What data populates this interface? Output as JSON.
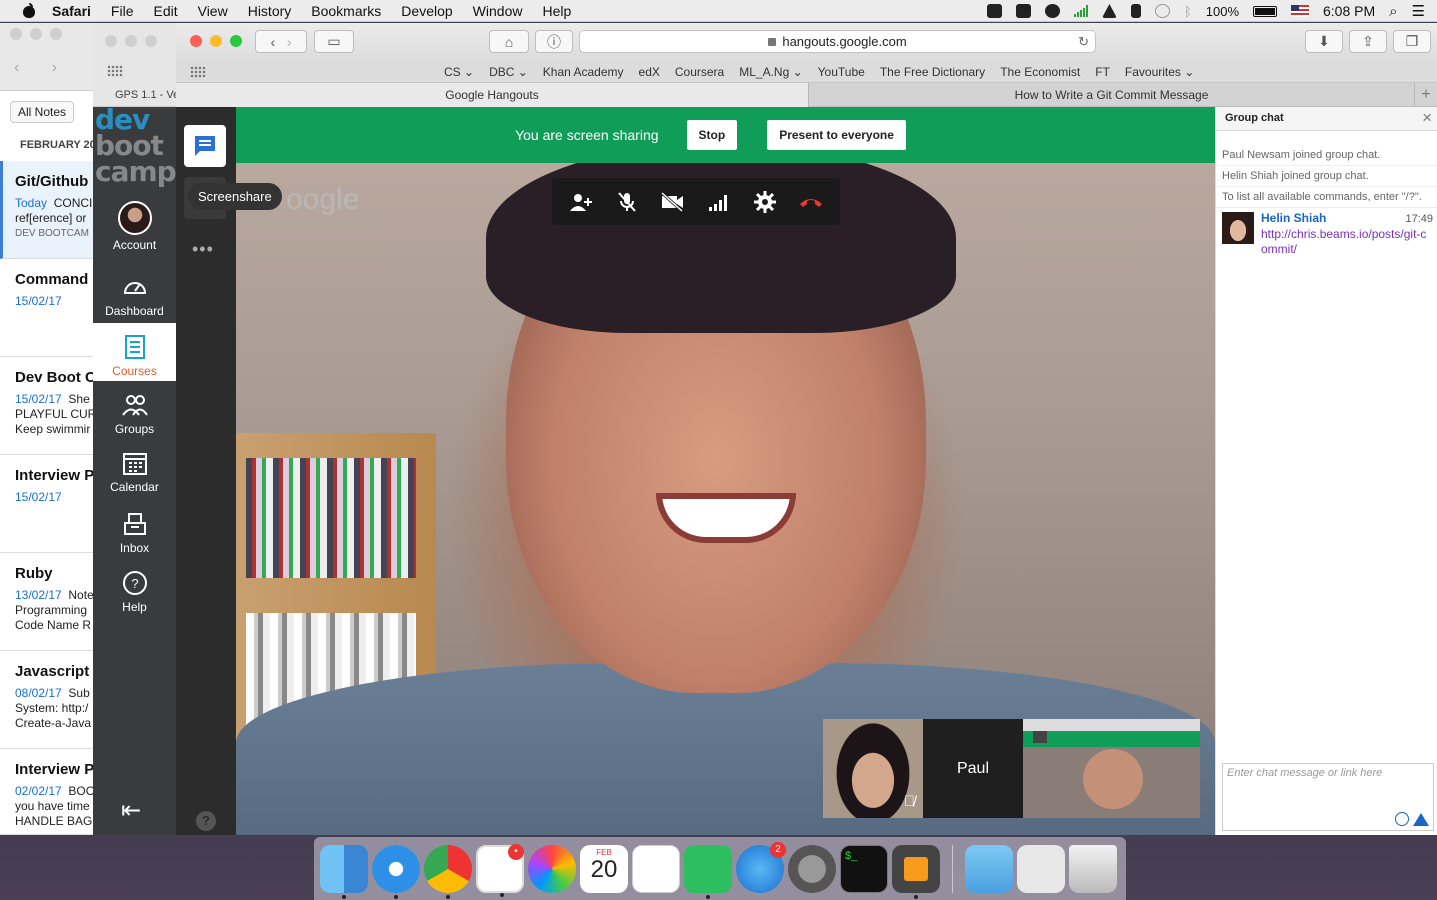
{
  "menubar": {
    "app": "Safari",
    "items": [
      "File",
      "Edit",
      "View",
      "History",
      "Bookmarks",
      "Develop",
      "Window",
      "Help"
    ],
    "battery": "100%",
    "clock": "6:08 PM"
  },
  "notes": {
    "all_notes": "All Notes",
    "month": "FEBRUARY 20",
    "items": [
      {
        "title": "Git/Github",
        "date": "Today",
        "snippet1": "CONCI",
        "snippet2": "ref[erence] or",
        "tag": "DEV BOOTCAM"
      },
      {
        "title": "Command l",
        "date": "15/02/17",
        "snippet1": "",
        "snippet2": "",
        "tag": ""
      },
      {
        "title": "Dev Boot C",
        "date": "15/02/17",
        "snippet1": "She",
        "snippet2": "PLAYFUL CUR",
        "snippet3": "Keep swimmir"
      },
      {
        "title": "Interview P",
        "date": "15/02/17",
        "snippet1": "",
        "snippet2": ""
      },
      {
        "title": "Ruby",
        "date": "13/02/17",
        "snippet1": "Note",
        "snippet2": "Programming",
        "snippet3": "Code Name R"
      },
      {
        "title": "Javascript",
        "date": "08/02/17",
        "snippet1": "Sub",
        "snippet2": "System: http:/",
        "snippet3": "Create-a-Java"
      },
      {
        "title": "Interview P",
        "date": "02/02/17",
        "snippet1": "BOO",
        "snippet2": "you have time",
        "snippet3": "HANDLE BAG"
      }
    ]
  },
  "dbc": {
    "logo": [
      "dev",
      "boot",
      "camp"
    ],
    "nav": [
      {
        "label": "Account",
        "icon": "avatar-icon"
      },
      {
        "label": "Dashboard",
        "icon": "gauge-icon"
      },
      {
        "label": "Courses",
        "icon": "notebook-icon"
      },
      {
        "label": "Groups",
        "icon": "people-icon"
      },
      {
        "label": "Calendar",
        "icon": "calendar-icon"
      },
      {
        "label": "Inbox",
        "icon": "inbox-icon"
      },
      {
        "label": "Help",
        "icon": "help-icon"
      }
    ]
  },
  "safari": {
    "back_tab": "GPS 1.1 - Ve",
    "url": "hangouts.google.com",
    "bookmarks": [
      "CS ⌄",
      "DBC ⌄",
      "Khan Academy",
      "edX",
      "Coursera",
      "ML_A.Ng ⌄",
      "YouTube",
      "The Free Dictionary",
      "The Economist",
      "FT",
      "Favourites ⌄"
    ],
    "tabs": [
      "Google Hangouts",
      "How to Write a Git Commit Message"
    ]
  },
  "hangouts": {
    "banner_msg": "You are screen sharing",
    "stop": "Stop",
    "present": "Present to everyone",
    "tooltip": "Screenshare",
    "watermark": "oogle",
    "thumb_name": "Paul"
  },
  "chat": {
    "title": "Group chat",
    "system": [
      "Paul Newsam joined group chat.",
      "Helin Shiah joined group chat.",
      "To list all available commands, enter \"/?\"."
    ],
    "message": {
      "name": "Helin Shiah",
      "time": "17:49",
      "link": "http://chris.beams.io/posts/git-commit/"
    },
    "placeholder": "Enter chat message or link here"
  },
  "dock": {
    "calendar_month": "FEB",
    "calendar_day": "20",
    "appstore_badge": "2"
  },
  "colors": {
    "green": "#0f9d58",
    "courses": "#e05a2a",
    "link": "#1a66c8"
  }
}
